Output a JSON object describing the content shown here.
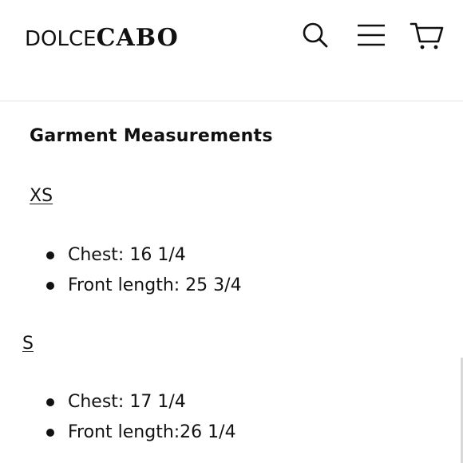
{
  "header": {
    "logo_light": "DOLCE",
    "logo_bold": "CABO",
    "icons": {
      "search": "search-icon",
      "menu": "hamburger-menu-icon",
      "cart": "cart-icon"
    }
  },
  "content": {
    "title": "Garment Measurements",
    "sizes": [
      {
        "label": "XS",
        "items": [
          {
            "text": "Chest: 16 1/4"
          },
          {
            "text": "Front length: 25 3/4"
          }
        ]
      },
      {
        "label": "S",
        "items": [
          {
            "text": "Chest: 17 1/4"
          },
          {
            "text": "Front length:26 1/4"
          }
        ]
      }
    ]
  },
  "colors": {
    "text": "#111111",
    "background": "#ffffff",
    "divider": "#e4e4e4"
  }
}
